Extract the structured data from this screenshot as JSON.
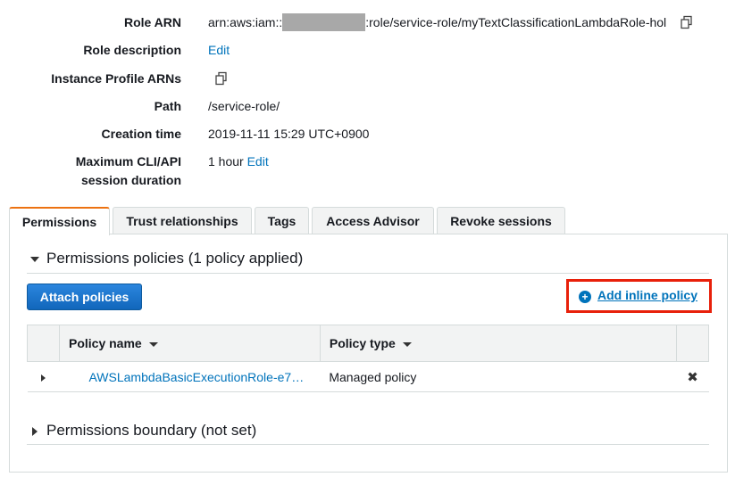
{
  "summary": {
    "role_arn_label": "Role ARN",
    "role_arn_prefix": "arn:aws:iam::",
    "role_arn_suffix": ":role/service-role/myTextClassificationLambdaRole-hol",
    "role_description_label": "Role description",
    "role_description_edit": "Edit",
    "instance_profile_label": "Instance Profile ARNs",
    "path_label": "Path",
    "path_value": "/service-role/",
    "creation_time_label": "Creation time",
    "creation_time_value": "2019-11-11 15:29 UTC+0900",
    "max_session_label_line1": "Maximum CLI/API",
    "max_session_label_line2": "session duration",
    "max_session_value": "1 hour",
    "max_session_edit": "Edit"
  },
  "tabs": [
    {
      "label": "Permissions",
      "active": true
    },
    {
      "label": "Trust relationships",
      "active": false
    },
    {
      "label": "Tags",
      "active": false
    },
    {
      "label": "Access Advisor",
      "active": false
    },
    {
      "label": "Revoke sessions",
      "active": false
    }
  ],
  "permissions": {
    "section_title": "Permissions policies (1 policy applied)",
    "attach_button": "Attach policies",
    "add_inline": "Add inline policy",
    "columns": [
      "Policy name",
      "Policy type"
    ],
    "rows": [
      {
        "name": "AWSLambdaBasicExecutionRole-e7…",
        "type": "Managed policy"
      }
    ],
    "boundary_title": "Permissions boundary (not set)"
  },
  "colors": {
    "link": "#0073bb",
    "primary_button": "#1f78d1",
    "active_tab_accent": "#ec7211",
    "highlight_box": "#e8200a"
  }
}
